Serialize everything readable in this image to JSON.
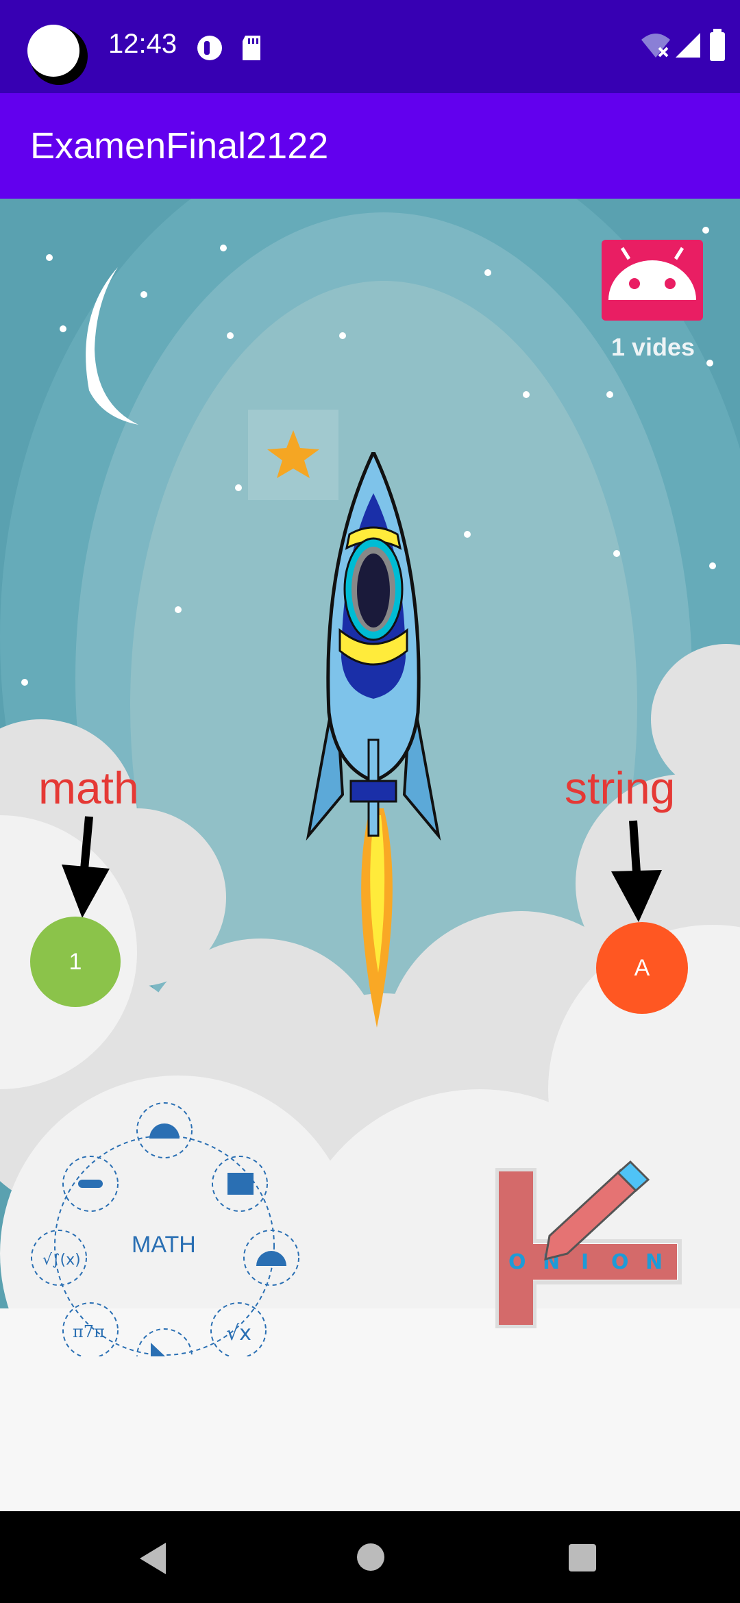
{
  "status_bar": {
    "time": "12:43",
    "background": "#3700B3"
  },
  "app_bar": {
    "title": "ExamenFinal2122",
    "background": "#6200EE"
  },
  "content": {
    "android_icon_badge": {
      "caption": "1 vides",
      "color": "#E91E63"
    },
    "star_icon": {
      "color": "#F5A623"
    },
    "math_label": "math",
    "string_label": "string",
    "math_button": {
      "label": "1",
      "color": "#8BC34A"
    },
    "string_button": {
      "label": "A",
      "color": "#FF5722"
    },
    "math_logo": {
      "text": "MATH"
    },
    "word_logo": {
      "letters": [
        "O",
        "N",
        "I",
        "O",
        "N"
      ]
    }
  },
  "nav_bar": {
    "back": "back-icon",
    "home": "home-icon",
    "recents": "recents-icon"
  }
}
